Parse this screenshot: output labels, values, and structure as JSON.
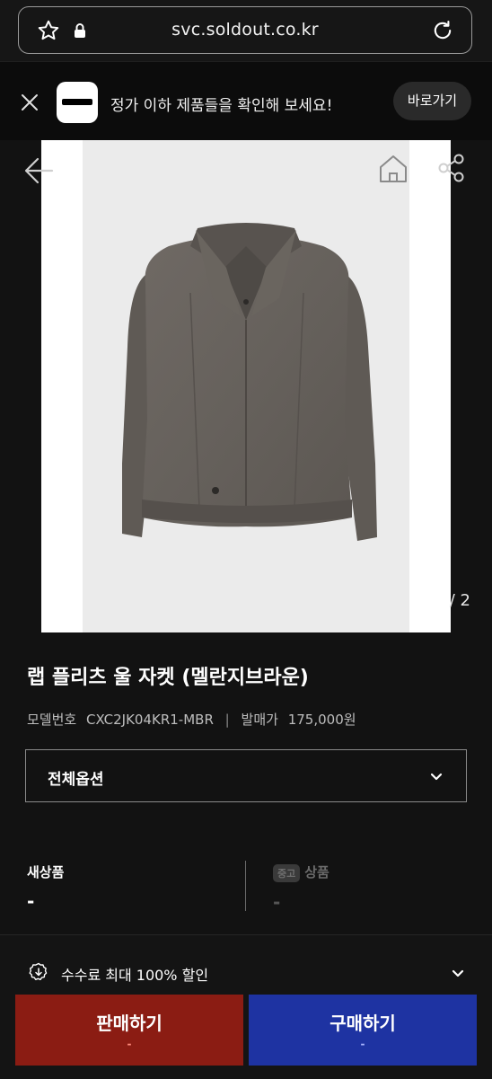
{
  "browser": {
    "url": "svc.soldout.co.kr"
  },
  "banner": {
    "message": "정가 이하 제품들을 확인해 보세요!",
    "button_label": "바로가기"
  },
  "gallery": {
    "pager_text": "/ 2"
  },
  "product": {
    "title": "랩 플리츠 울 자켓 (멜란지브라운)",
    "model_label": "모델번호",
    "model_number": "CXC2JK04KR1-MBR",
    "release_label": "발매가",
    "release_price": "175,000원"
  },
  "option_select": {
    "label": "전체옵션"
  },
  "price_summary": {
    "new": {
      "label": "새상품",
      "value": "-"
    },
    "used": {
      "badge": "중고",
      "label": "상품",
      "value": "-"
    }
  },
  "discount": {
    "text": "수수료 최대 100% 할인"
  },
  "actions": {
    "sell": {
      "label": "판매하기",
      "sub": "-"
    },
    "buy": {
      "label": "구매하기",
      "sub": "-"
    }
  },
  "colors": {
    "sell": "#8b1c13",
    "buy": "#1e33a2",
    "background": "#121212"
  }
}
